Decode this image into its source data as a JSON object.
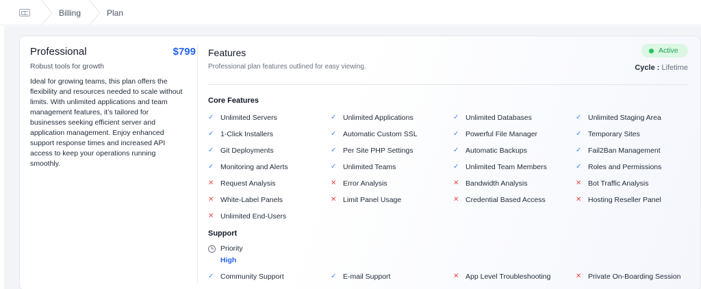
{
  "breadcrumb": {
    "home_icon": "card-icon",
    "items": [
      "Billing",
      "Plan"
    ]
  },
  "plan": {
    "name": "Professional",
    "price": "$799",
    "tagline": "Robust tools for growth",
    "description": "Ideal for growing teams, this plan offers the flexibility and resources needed to scale without limits. With unlimited applications and team management features, it’s tailored for businesses seeking efficient server and application management. Enjoy enhanced support response times and increased API access to keep your operations running smoothly."
  },
  "features": {
    "title": "Features",
    "subtitle": "Professional plan features outlined for easy viewing.",
    "status": "Active",
    "cycle_label": "Cycle :",
    "cycle_value": "Lifetime"
  },
  "core": {
    "title": "Core Features",
    "items": [
      {
        "label": "Unlimited Servers",
        "included": true
      },
      {
        "label": "Unlimited Applications",
        "included": true
      },
      {
        "label": "Unlimited Databases",
        "included": true
      },
      {
        "label": "Unlimited Staging Area",
        "included": true
      },
      {
        "label": "1-Click Installers",
        "included": true
      },
      {
        "label": "Automatic Custom SSL",
        "included": true
      },
      {
        "label": "Powerful File Manager",
        "included": true
      },
      {
        "label": "Temporary Sites",
        "included": true
      },
      {
        "label": "Git Deployments",
        "included": true
      },
      {
        "label": "Per Site PHP Settings",
        "included": true
      },
      {
        "label": "Automatic Backups",
        "included": true
      },
      {
        "label": "Fail2Ban Management",
        "included": true
      },
      {
        "label": "Monitoring and Alerts",
        "included": true
      },
      {
        "label": "Unlimited Teams",
        "included": true
      },
      {
        "label": "Unlimited Team Members",
        "included": true
      },
      {
        "label": "Roles and Permissions",
        "included": true
      },
      {
        "label": "Request Analysis",
        "included": false
      },
      {
        "label": "Error Analysis",
        "included": false
      },
      {
        "label": "Bandwidth Analysis",
        "included": false
      },
      {
        "label": "Bot Traffic Analysis",
        "included": false
      },
      {
        "label": "White-Label Panels",
        "included": false
      },
      {
        "label": "Limit Panel Usage",
        "included": false
      },
      {
        "label": "Credential Based Access",
        "included": false
      },
      {
        "label": "Hosting Reseller Panel",
        "included": false
      },
      {
        "label": "Unlimited End-Users",
        "included": false
      }
    ]
  },
  "support": {
    "title": "Support",
    "priority_label": "Priority",
    "priority_value": "High",
    "items": [
      {
        "label": "Community Support",
        "included": true
      },
      {
        "label": "E-mail Support",
        "included": true
      },
      {
        "label": "App Level Troubleshooting",
        "included": false
      },
      {
        "label": "Private On-Boarding Session",
        "included": false
      }
    ]
  },
  "colors": {
    "accent": "#2563eb",
    "check": "#3b82f6",
    "cross": "#ef4444",
    "active_bg": "#dcf7e3",
    "active_text": "#16a34a"
  }
}
